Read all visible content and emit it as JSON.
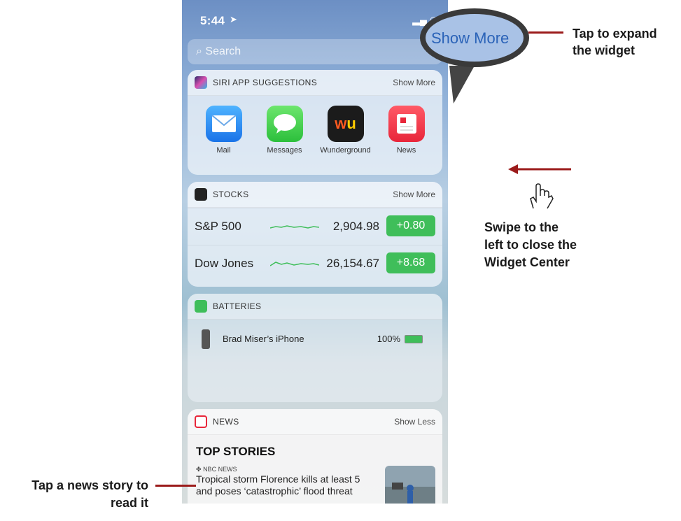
{
  "status": {
    "time": "5:44"
  },
  "search": {
    "placeholder": "Search"
  },
  "callout_top": {
    "bubble_text": "Show More",
    "label_line1": "Tap to expand",
    "label_line2": "the widget"
  },
  "swipe_hint": {
    "line1": "Swipe to the",
    "line2": "left to close the",
    "line3": "Widget Center"
  },
  "news_hint": {
    "line1": "Tap a news story to",
    "line2": "read it"
  },
  "siri": {
    "title": "SIRI APP SUGGESTIONS",
    "more": "Show More",
    "apps": [
      {
        "label": "Mail",
        "icon": "mail-icon",
        "color": "#2d8cf0"
      },
      {
        "label": "Messages",
        "icon": "messages-icon",
        "color": "#4cd964"
      },
      {
        "label": "Wunderground",
        "icon": "wunderground-icon",
        "color": "#1b1b1b"
      },
      {
        "label": "News",
        "icon": "news-icon",
        "color": "#f0394b"
      }
    ]
  },
  "stocks": {
    "title": "STOCKS",
    "more": "Show More",
    "rows": [
      {
        "name": "S&P 500",
        "price": "2,904.98",
        "change": "+0.80"
      },
      {
        "name": "Dow Jones",
        "price": "26,154.67",
        "change": "+8.68"
      }
    ]
  },
  "batteries": {
    "title": "BATTERIES",
    "device": "Brad Miser’s iPhone",
    "percent": "100%",
    "level": 1.0
  },
  "news": {
    "title": "NEWS",
    "more": "Show Less",
    "section": "TOP STORIES",
    "source": "NBC NEWS",
    "headline": "Tropical storm Florence kills at least 5 and poses ‘catastrophic’ flood threat"
  },
  "colors": {
    "accent_red": "#9b1b1b",
    "stock_green": "#3fbe5a"
  }
}
